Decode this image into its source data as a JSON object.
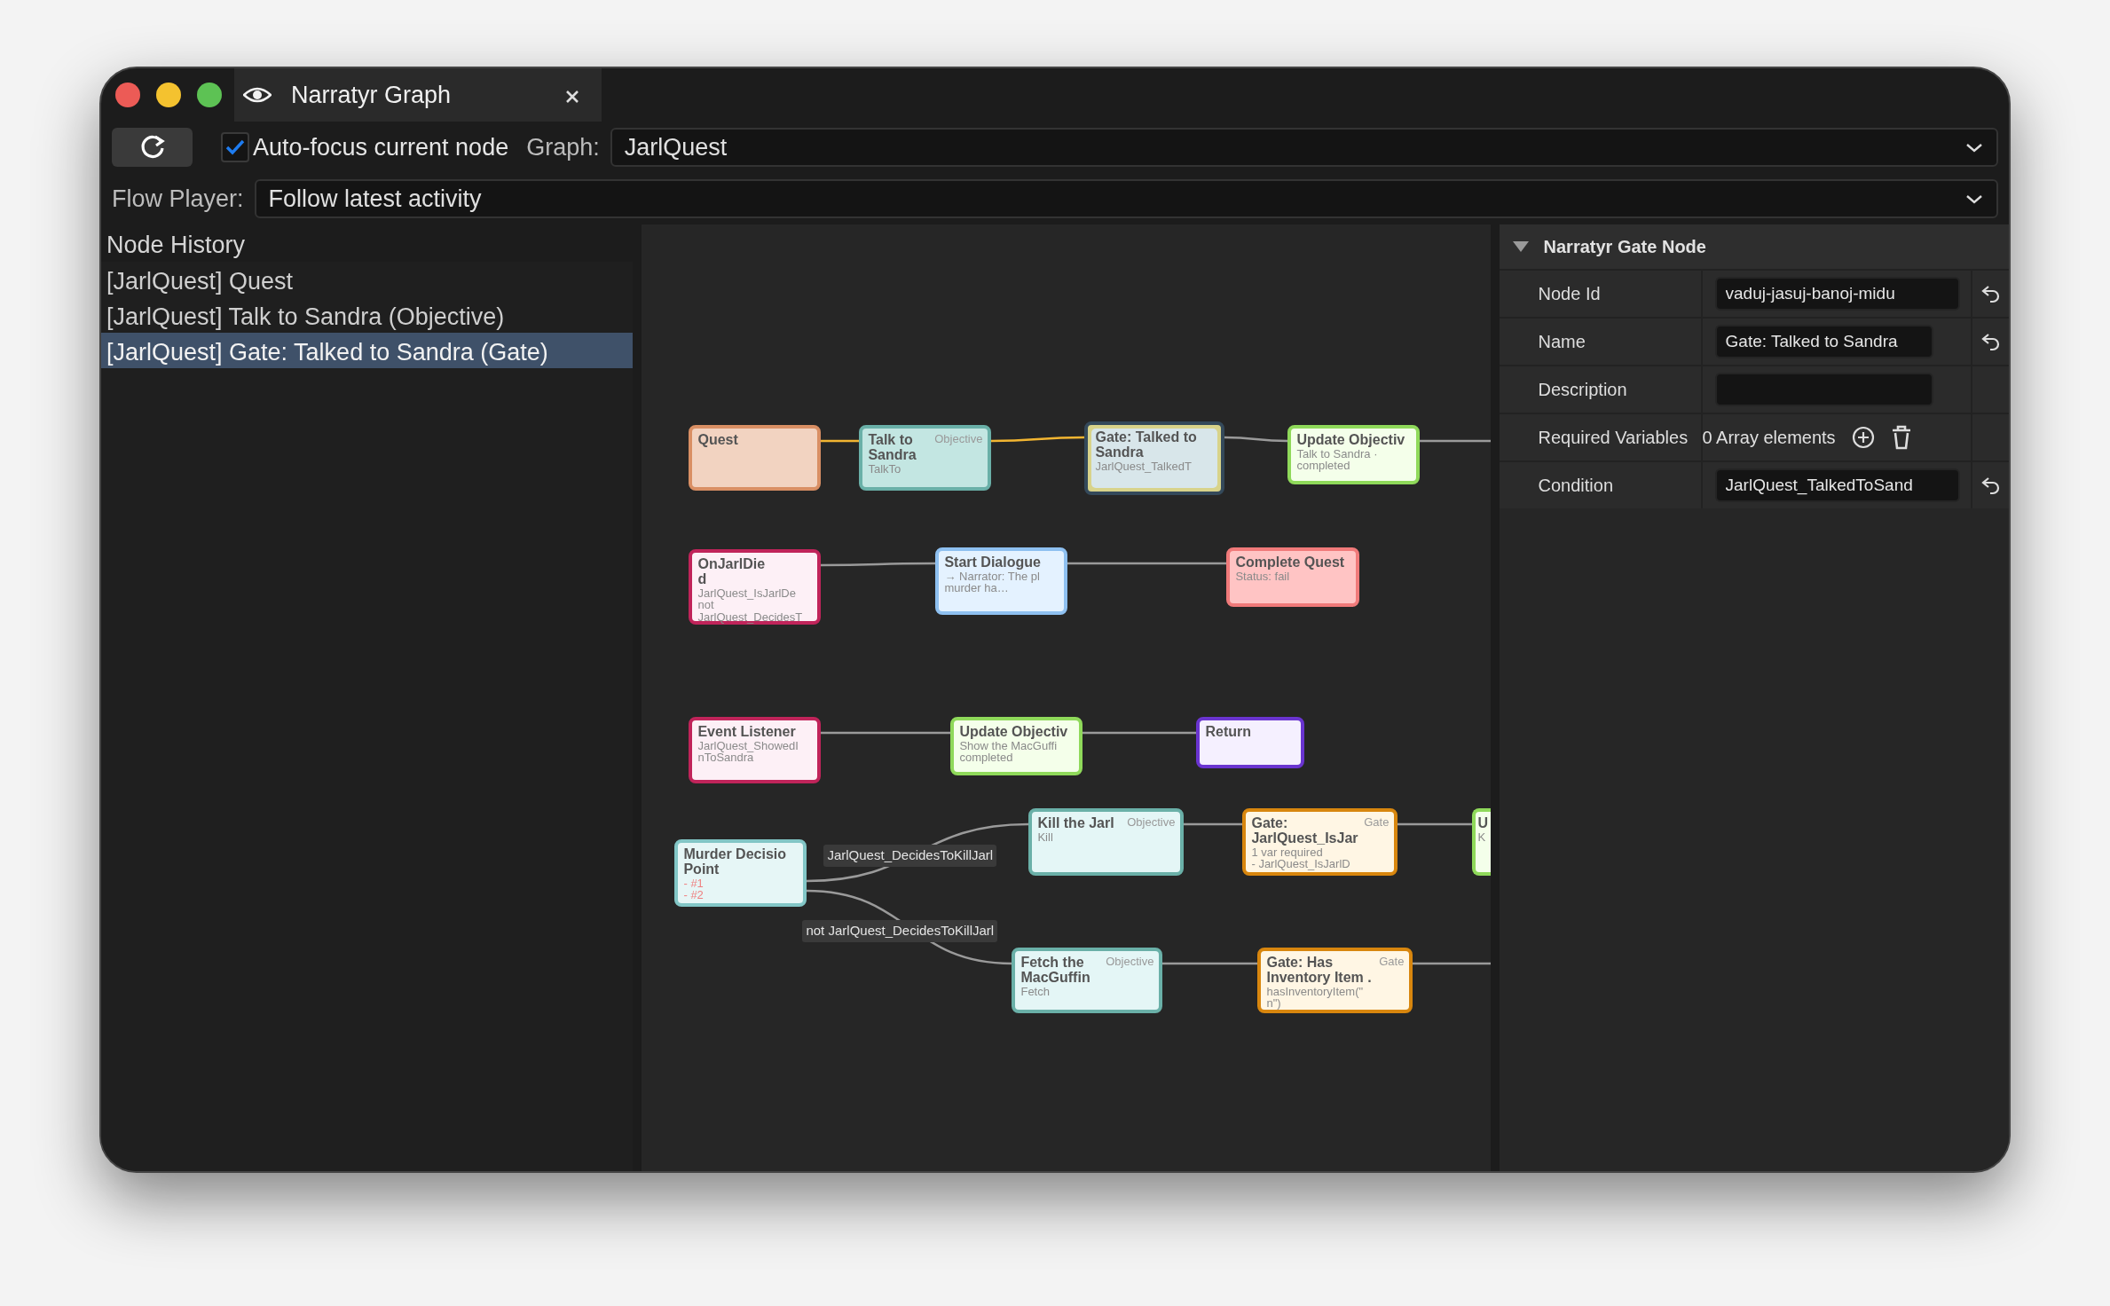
{
  "window": {
    "title": "Narratyr Graph"
  },
  "toolbar": {
    "auto_focus": {
      "label": "Auto-focus current node",
      "checked": true
    },
    "graph": {
      "label": "Graph:",
      "value": "JarlQuest"
    }
  },
  "flow_player": {
    "label": "Flow Player:",
    "value": "Follow latest activity"
  },
  "node_history": {
    "title": "Node History",
    "items": [
      {
        "label": "[JarlQuest] Quest",
        "selected": false
      },
      {
        "label": "[JarlQuest] Talk to Sandra (Objective)",
        "selected": false
      },
      {
        "label": "[JarlQuest] Gate: Talked to Sandra (Gate)",
        "selected": true
      }
    ]
  },
  "graph": {
    "nodes": [
      {
        "kind": "quest",
        "title_lines": [
          "Quest"
        ],
        "visited": true,
        "selected": false
      },
      {
        "kind": "objective",
        "title_lines": [
          "Talk to",
          "Sandra"
        ],
        "type_label": "Objective",
        "lines": [
          "TalkTo"
        ],
        "visited": true,
        "selected": false
      },
      {
        "kind": "gate_current",
        "title_lines": [
          "Gate: Talked to",
          "Sandra"
        ],
        "lines": [
          "JarlQuest_TalkedT"
        ],
        "visited": true,
        "selected": true
      },
      {
        "kind": "update_objective",
        "title_lines": [
          "Update Objectiv"
        ],
        "lines": [
          "Talk to Sandra ·",
          "completed"
        ],
        "visited": false,
        "selected": false
      },
      {
        "kind": "event_listener",
        "title_lines": [
          "OnJarlDie",
          "d"
        ],
        "lines": [
          "JarlQuest_IsJarlDe",
          "not",
          "JarlQuest_DecidesT"
        ],
        "visited": false,
        "selected": false
      },
      {
        "kind": "dialogue",
        "title_lines": [
          "Start Dialogue"
        ],
        "lines": [
          "→ Narrator: The pl",
          "murder ha…"
        ],
        "visited": false,
        "selected": false
      },
      {
        "kind": "complete_quest",
        "title_lines": [
          "Complete Quest"
        ],
        "lines": [
          "Status: fail"
        ],
        "visited": false,
        "selected": false
      },
      {
        "kind": "event_listener",
        "title_lines": [
          "Event Listener"
        ],
        "lines": [
          "JarlQuest_ShowedI",
          "nToSandra"
        ],
        "visited": false,
        "selected": false
      },
      {
        "kind": "update_objective",
        "title_lines": [
          "Update Objectiv"
        ],
        "lines": [
          "Show the MacGuffi",
          "completed"
        ],
        "visited": false,
        "selected": false
      },
      {
        "kind": "return",
        "title_lines": [
          "Return"
        ],
        "visited": false,
        "selected": false
      },
      {
        "kind": "hub",
        "title_lines": [
          "Murder Decisio",
          "Point"
        ],
        "branches": [
          "- #1",
          "- #2"
        ],
        "visited": false,
        "selected": false
      },
      {
        "kind": "objective",
        "title_lines": [
          "Kill the Jarl"
        ],
        "type_label": "Objective",
        "lines": [
          "Kill"
        ],
        "visited": false,
        "selected": false
      },
      {
        "kind": "gate",
        "title_lines": [
          "Gate:",
          "JarlQuest_IsJar"
        ],
        "type_label": "Gate",
        "lines": [
          "1 var required",
          "- JarlQuest_IsJarlD"
        ],
        "visited": false,
        "selected": false
      },
      {
        "kind": "update_objective",
        "title_lines": [
          "U"
        ],
        "lines": [
          "K"
        ],
        "visited": false,
        "selected": false
      },
      {
        "kind": "objective",
        "title_lines": [
          "Fetch the",
          "MacGuffin"
        ],
        "type_label": "Objective",
        "lines": [
          "Fetch"
        ],
        "visited": false,
        "selected": false
      },
      {
        "kind": "gate",
        "title_lines": [
          "Gate: Has",
          "Inventory Item ."
        ],
        "type_label": "Gate",
        "lines": [
          "hasInventoryItem(\"",
          "n\")"
        ],
        "visited": false,
        "selected": false
      }
    ],
    "edges": [
      {
        "active": true
      },
      {
        "active": true
      },
      {
        "active": false
      },
      {
        "active": false
      },
      {
        "active": false
      },
      {
        "active": false
      },
      {
        "active": false
      },
      {
        "active": false
      },
      {
        "active": false,
        "label": "JarlQuest_DecidesToKillJarl"
      },
      {
        "active": false,
        "label": "not JarlQuest_DecidesToKillJarl"
      },
      {
        "active": false
      },
      {
        "active": false
      },
      {
        "active": false
      },
      {
        "active": false
      }
    ]
  },
  "inspector": {
    "title": "Narratyr Gate Node",
    "expanded": true,
    "properties": [
      {
        "kind": "text",
        "label": "Node Id",
        "value": "vaduj-jasuj-banoj-midu",
        "resettable": true
      },
      {
        "kind": "text",
        "label": "Name",
        "value": "Gate: Talked to Sandra",
        "resettable": true
      },
      {
        "kind": "text",
        "label": "Description",
        "resettable": false
      },
      {
        "kind": "array",
        "label": "Required Variables",
        "value": "0 Array elements",
        "resettable": false
      },
      {
        "kind": "text",
        "label": "Condition",
        "value": "JarlQuest_TalkedToSand",
        "resettable": true
      }
    ]
  }
}
